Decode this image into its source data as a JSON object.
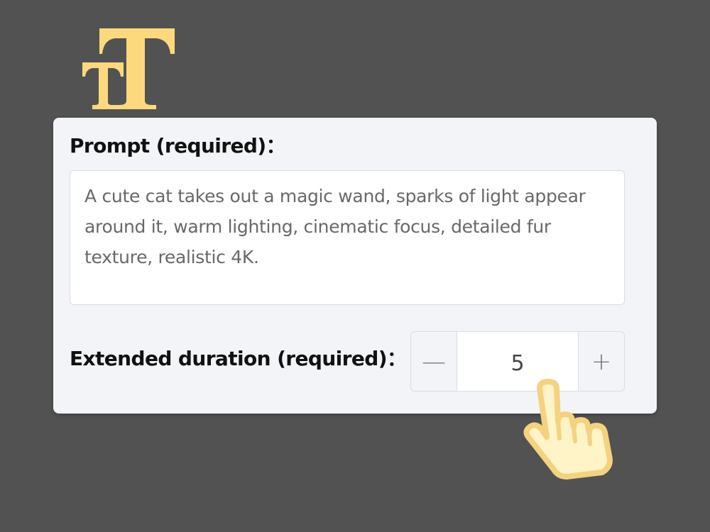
{
  "icons": {
    "text_size": "text-size-icon",
    "pointer": "hand-pointer-icon",
    "minus": "minus-icon",
    "plus": "plus-icon"
  },
  "colors": {
    "background": "#525252",
    "card": "#f3f4f8",
    "accent_icon": "#fcd97d",
    "icon_outline": "#f6d98a"
  },
  "form": {
    "prompt": {
      "label": "Prompt (required)：",
      "value": "A cute cat takes out a magic wand, sparks of light appear around it, warm lighting, cinematic focus, detailed fur texture, realistic 4K."
    },
    "duration": {
      "label": "Extended duration (required)：",
      "value": "5",
      "decrement_symbol": "—",
      "increment_symbol": "+"
    }
  }
}
